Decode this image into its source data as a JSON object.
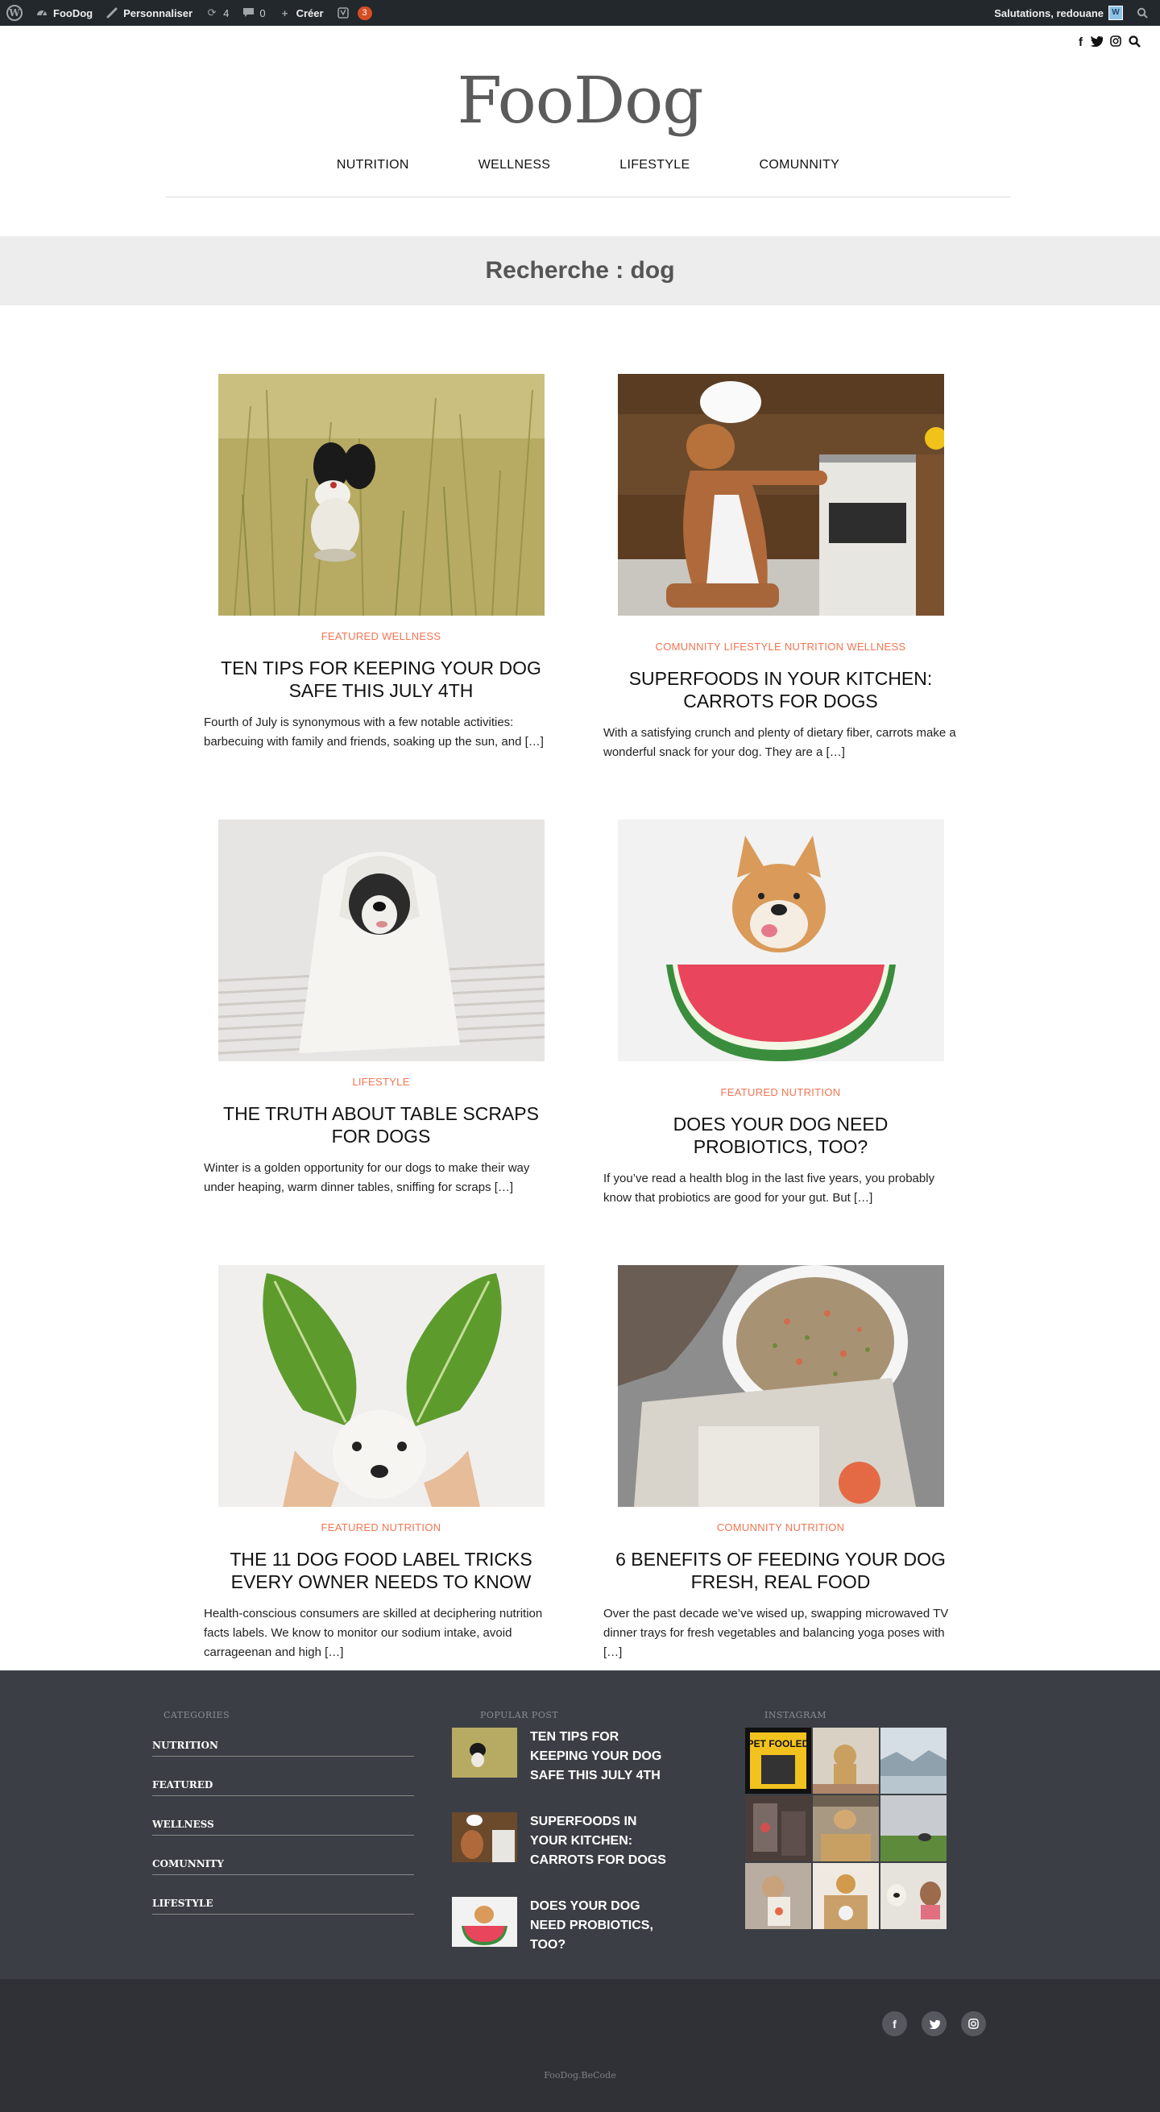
{
  "adminbar": {
    "site_name": "FooDog",
    "customize": "Personnaliser",
    "updates_count": "4",
    "comments_count": "0",
    "create": "Créer",
    "yoast_badge": "3",
    "greeting": "Salutations, redouane"
  },
  "site": {
    "logo": "FooDog"
  },
  "nav": [
    "NUTRITION",
    "WELLNESS",
    "LIFESTYLE",
    "COMUNNITY"
  ],
  "search": {
    "title": "Recherche : dog"
  },
  "posts": [
    {
      "cats": "FEATURED WELLNESS",
      "title": "TEN TIPS FOR KEEPING YOUR DOG SAFE THIS JULY 4TH",
      "excerpt": "Fourth of July is synonymous with a few notable activities: barbecuing with family and friends, soaking up the sun, and […]"
    },
    {
      "cats": "COMUNNITY LIFESTYLE NUTRITION WELLNESS",
      "title": "SUPERFOODS IN YOUR KITCHEN: CARROTS FOR DOGS",
      "excerpt": "With a satisfying crunch and plenty of dietary fiber, carrots make a wonderful snack for your dog. They are a […]"
    },
    {
      "cats": "LIFESTYLE",
      "title": "THE TRUTH ABOUT TABLE SCRAPS FOR DOGS",
      "excerpt": "Winter is a golden opportunity for our dogs to make their way under heaping, warm dinner tables, sniffing for scraps […]"
    },
    {
      "cats": "FEATURED NUTRITION",
      "title": "DOES YOUR DOG NEED PROBIOTICS, TOO?",
      "excerpt": "If you’ve read a health blog in the last five years, you probably know that probiotics are good for your gut. But […]"
    },
    {
      "cats": "FEATURED NUTRITION",
      "title": "THE 11 DOG FOOD LABEL TRICKS EVERY OWNER NEEDS TO KNOW",
      "excerpt": "Health-conscious consumers are skilled at deciphering nutrition facts labels. We know to monitor our sodium intake, avoid carrageenan and high […]"
    },
    {
      "cats": "COMUNNITY NUTRITION",
      "title": "6 BENEFITS OF FEEDING YOUR DOG FRESH, REAL FOOD",
      "excerpt": "Over the past decade we’ve wised up, swapping microwaved TV dinner trays for fresh vegetables and balancing yoga poses with […]"
    }
  ],
  "footer": {
    "categories_heading": "CATEGORIES",
    "categories": [
      "NUTRITION",
      "FEATURED",
      "WELLNESS",
      "COMUNNITY",
      "LIFESTYLE"
    ],
    "popular_heading": "POPULAR POST",
    "popular": [
      "TEN TIPS FOR KEEPING YOUR DOG SAFE THIS JULY 4TH",
      "SUPERFOODS IN YOUR KITCHEN: CARROTS FOR DOGS",
      "DOES YOUR DOG NEED PROBIOTICS, TOO?"
    ],
    "instagram_heading": "INSTAGRAM",
    "insta_text": "PET FOOLED",
    "copyright": "FooDog.BeCode"
  },
  "icons": [
    "wordpress-icon",
    "dashboard-icon",
    "brush-icon",
    "updates-icon",
    "comment-icon",
    "plus-icon",
    "yoast-icon",
    "search-icon",
    "facebook-icon",
    "twitter-icon",
    "instagram-icon"
  ]
}
